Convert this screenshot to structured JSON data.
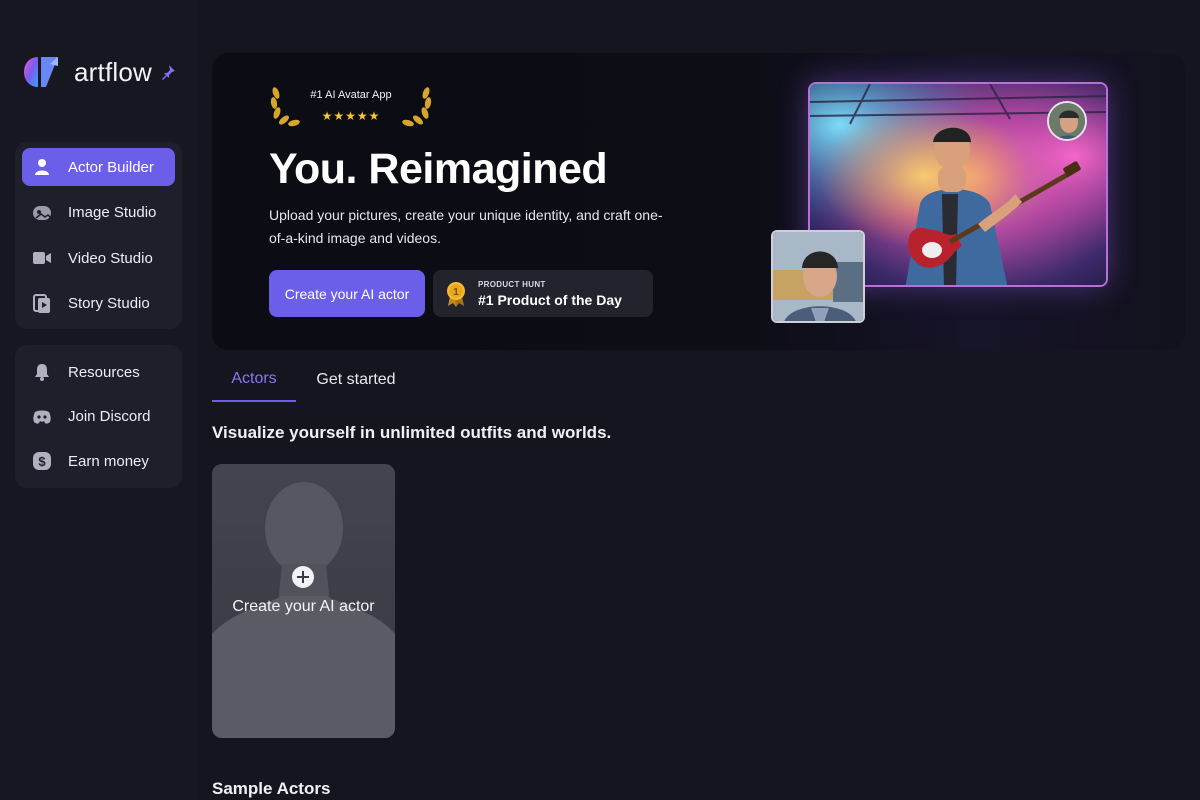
{
  "brand": {
    "name": "artflow",
    "logo": "artflow-logo",
    "pin_icon": "pin-icon"
  },
  "colors": {
    "accent": "#6b5ee9",
    "accent_text": "#8479f0",
    "background": "#15151f",
    "sidebar_group": "#1f1f2c",
    "star": "#f7c33b"
  },
  "sidebar": {
    "primary": [
      {
        "label": "Actor Builder",
        "icon": "person-icon",
        "active": true
      },
      {
        "label": "Image Studio",
        "icon": "image-studio-icon",
        "active": false
      },
      {
        "label": "Video Studio",
        "icon": "video-camera-icon",
        "active": false
      },
      {
        "label": "Story Studio",
        "icon": "story-icon",
        "active": false
      }
    ],
    "secondary": [
      {
        "label": "Resources",
        "icon": "bell-icon"
      },
      {
        "label": "Join Discord",
        "icon": "discord-icon"
      },
      {
        "label": "Earn money",
        "icon": "dollar-icon"
      }
    ]
  },
  "hero": {
    "award_title": "#1 AI Avatar App",
    "award_stars": "★★★★★",
    "title": "You. Reimagined",
    "description": "Upload your pictures, create your unique identity, and craft one-of-a-kind image and videos.",
    "cta_label": "Create your AI actor",
    "product_hunt": {
      "small": "PRODUCT HUNT",
      "big": "#1 Product of the Day",
      "medal_number": "1"
    }
  },
  "tabs": [
    {
      "label": "Actors",
      "active": true
    },
    {
      "label": "Get started",
      "active": false
    }
  ],
  "main": {
    "section_heading": "Visualize yourself in unlimited outfits and worlds.",
    "create_card_label": "Create your AI actor",
    "sample_heading": "Sample Actors"
  }
}
